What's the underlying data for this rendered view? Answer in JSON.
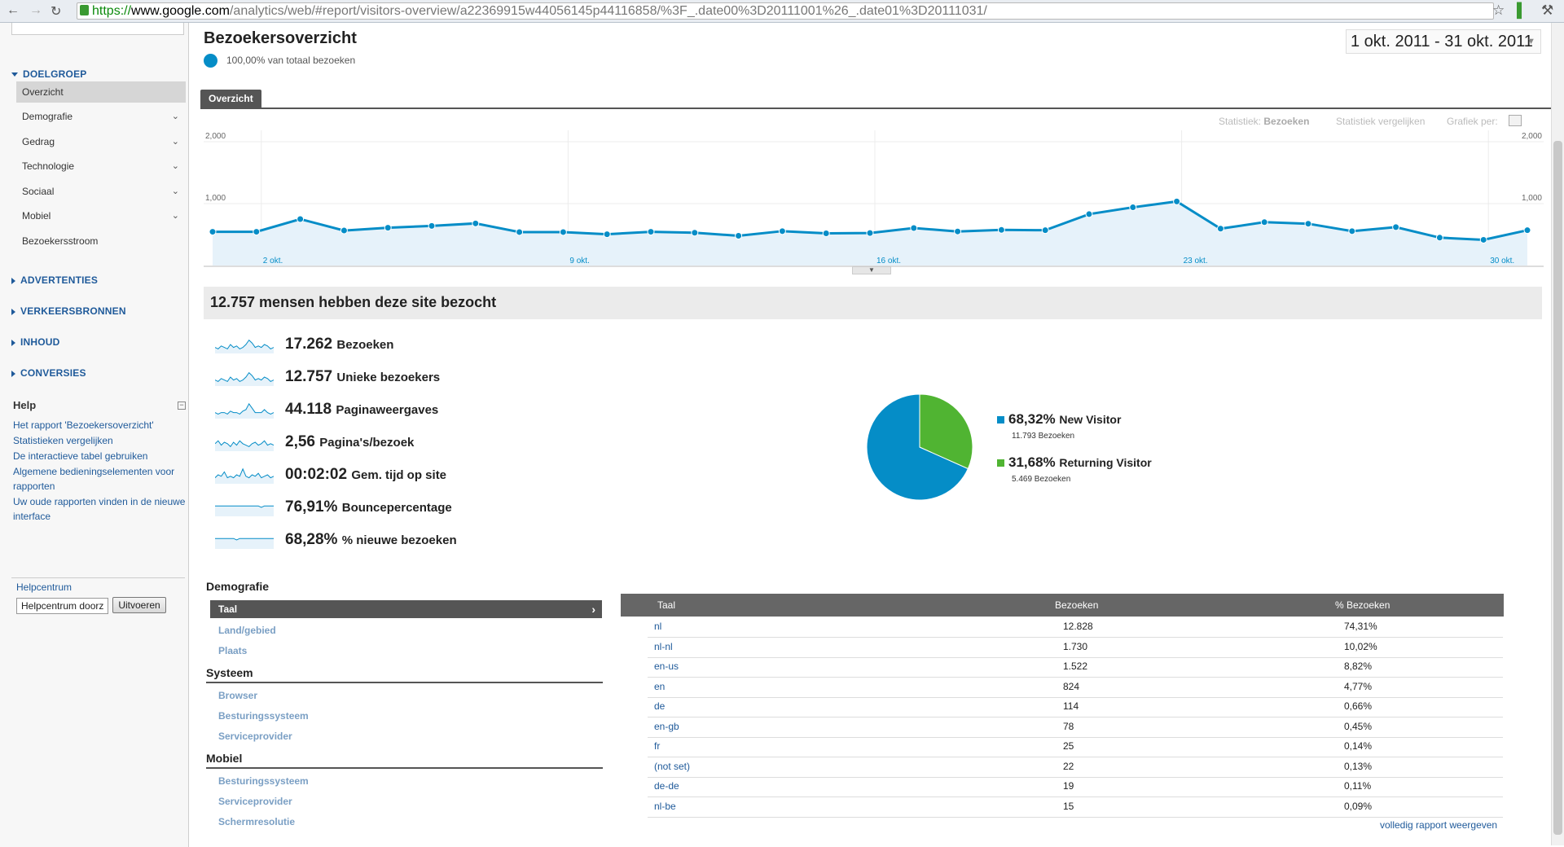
{
  "browser": {
    "url_scheme": "https://",
    "url_host": "www.google.com",
    "url_path": "/analytics/web/#report/visitors-overview/a22369915w44056145p44116858/%3F_.date00%3D20111001%26_.date01%3D20111031/",
    "back_icon": "back-arrow-icon",
    "forward_icon": "forward-arrow-icon",
    "reload_icon": "reload-icon"
  },
  "sidebar": {
    "doelgroep_label": "DOELGROEP",
    "items": [
      {
        "label": "Overzicht",
        "active": true
      },
      {
        "label": "Demografie",
        "expandable": true
      },
      {
        "label": "Gedrag",
        "expandable": true
      },
      {
        "label": "Technologie",
        "expandable": true
      },
      {
        "label": "Sociaal",
        "expandable": true
      },
      {
        "label": "Mobiel",
        "expandable": true
      },
      {
        "label": "Bezoekersstroom"
      }
    ],
    "sections": [
      "ADVERTENTIES",
      "VERKEERSBRONNEN",
      "INHOUD",
      "CONVERSIES"
    ],
    "help": {
      "title": "Help",
      "links": [
        "Het rapport 'Bezoekersoverzicht'",
        "Statistieken vergelijken",
        "De interactieve tabel gebruiken",
        "Algemene bedieningselementen voor rapporten",
        "Uw oude rapporten vinden in de nieuwe interface"
      ],
      "helpcentrum": "Helpcentrum",
      "search_value": "Helpcentrum doorz",
      "submit_label": "Uitvoeren"
    }
  },
  "header": {
    "title": "Bezoekersoverzicht",
    "segment_text": "100,00% van totaal bezoeken",
    "date_range": "1 okt. 2011 - 31 okt. 2011",
    "tab": "Overzicht",
    "statistiek_prefix": "Statistiek:",
    "statistiek_value": "Bezoeken",
    "vergelijken": "Statistiek vergelijken",
    "grafiek_per": "Grafiek per:"
  },
  "chart_data": {
    "type": "area",
    "series": [
      {
        "name": "Bezoeken",
        "values": [
          545,
          545,
          750,
          565,
          610,
          640,
          680,
          540,
          540,
          505,
          545,
          530,
          480,
          555,
          520,
          525,
          605,
          550,
          575,
          570,
          830,
          940,
          1035,
          595,
          700,
          675,
          555,
          620,
          450,
          415,
          570
        ]
      }
    ],
    "x": [
      "1 okt.",
      "2 okt.",
      "3 okt.",
      "4 okt.",
      "5 okt.",
      "6 okt.",
      "7 okt.",
      "8 okt.",
      "9 okt.",
      "10 okt.",
      "11 okt.",
      "12 okt.",
      "13 okt.",
      "14 okt.",
      "15 okt.",
      "16 okt.",
      "17 okt.",
      "18 okt.",
      "19 okt.",
      "20 okt.",
      "21 okt.",
      "22 okt.",
      "23 okt.",
      "24 okt.",
      "25 okt.",
      "26 okt.",
      "27 okt.",
      "28 okt.",
      "29 okt.",
      "30 okt.",
      "31 okt."
    ],
    "x_tick_labels": [
      "2 okt.",
      "9 okt.",
      "16 okt.",
      "23 okt.",
      "30 okt."
    ],
    "y_tick_labels": [
      "2,000",
      "1,000"
    ],
    "ylim": [
      0,
      2000
    ],
    "color": "#058dc7",
    "fill_color": "#e6f2fa"
  },
  "summary": {
    "headline": "12.757 mensen hebben deze site bezocht",
    "metrics": [
      {
        "value": "17.262",
        "label": "Bezoeken"
      },
      {
        "value": "12.757",
        "label": "Unieke bezoekers"
      },
      {
        "value": "44.118",
        "label": "Paginaweergaves"
      },
      {
        "value": "2,56",
        "label": "Pagina's/bezoek"
      },
      {
        "value": "00:02:02",
        "label": "Gem. tijd op site"
      },
      {
        "value": "76,91%",
        "label": "Bouncepercentage"
      },
      {
        "value": "68,28%",
        "label": "% nieuwe bezoeken"
      }
    ]
  },
  "pie": {
    "slices": [
      {
        "label": "New Visitor",
        "percent": "68,32%",
        "count": "11.793 Bezoeken",
        "fraction": 0.6832,
        "color": "#058dc7"
      },
      {
        "label": "Returning Visitor",
        "percent": "31,68%",
        "count": "5.469 Bezoeken",
        "fraction": 0.3168,
        "color": "#50b432"
      }
    ]
  },
  "dimensions": {
    "demografie": "Demografie",
    "taal": "Taal",
    "land": "Land/gebied",
    "plaats": "Plaats",
    "systeem": "Systeem",
    "browser": "Browser",
    "besturing1": "Besturingssysteem",
    "service1": "Serviceprovider",
    "mobiel": "Mobiel",
    "besturing2": "Besturingssysteem",
    "service2": "Serviceprovider",
    "scherm": "Schermresolutie"
  },
  "table": {
    "headers": [
      "Taal",
      "Bezoeken",
      "% Bezoeken"
    ],
    "rows": [
      [
        "nl",
        "12.828",
        "74,31%"
      ],
      [
        "nl-nl",
        "1.730",
        "10,02%"
      ],
      [
        "en-us",
        "1.522",
        "8,82%"
      ],
      [
        "en",
        "824",
        "4,77%"
      ],
      [
        "de",
        "114",
        "0,66%"
      ],
      [
        "en-gb",
        "78",
        "0,45%"
      ],
      [
        "fr",
        "25",
        "0,14%"
      ],
      [
        "(not set)",
        "22",
        "0,13%"
      ],
      [
        "de-de",
        "19",
        "0,11%"
      ],
      [
        "nl-be",
        "15",
        "0,09%"
      ]
    ],
    "full_report": "volledig rapport weergeven"
  }
}
